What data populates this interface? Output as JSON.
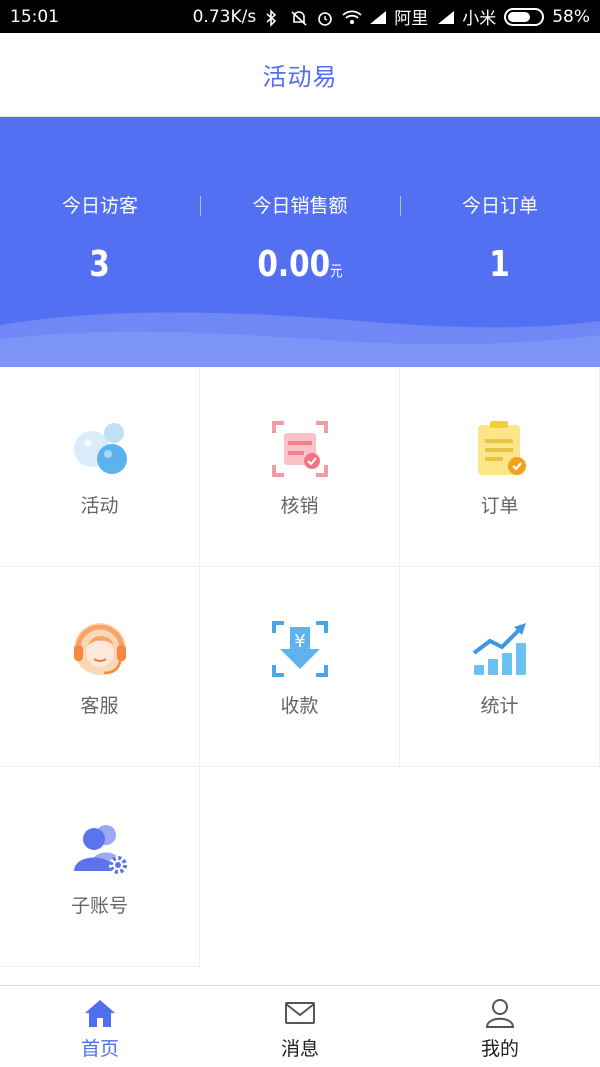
{
  "status_bar": {
    "time": "15:01",
    "speed": "0.73K/s",
    "carrier1": "阿里",
    "carrier2": "小米",
    "battery": "58%"
  },
  "header": {
    "title": "活动易"
  },
  "stats": [
    {
      "label": "今日访客",
      "value": "3",
      "unit": ""
    },
    {
      "label": "今日销售额",
      "value": "0.00",
      "unit": "元"
    },
    {
      "label": "今日订单",
      "value": "1",
      "unit": ""
    }
  ],
  "menu": [
    {
      "label": "活动",
      "icon": "bubbles-icon"
    },
    {
      "label": "核销",
      "icon": "scan-verify-icon"
    },
    {
      "label": "订单",
      "icon": "clipboard-check-icon"
    },
    {
      "label": "客服",
      "icon": "headset-icon"
    },
    {
      "label": "收款",
      "icon": "yuan-download-icon"
    },
    {
      "label": "统计",
      "icon": "bar-trend-icon"
    },
    {
      "label": "子账号",
      "icon": "users-gear-icon"
    }
  ],
  "tabbar": [
    {
      "label": "首页",
      "icon": "home-icon",
      "active": true
    },
    {
      "label": "消息",
      "icon": "mail-icon",
      "active": false
    },
    {
      "label": "我的",
      "icon": "user-icon",
      "active": false
    }
  ],
  "colors": {
    "primary": "#5470f2",
    "title": "#4f6ff0",
    "label_gray": "#666666"
  }
}
